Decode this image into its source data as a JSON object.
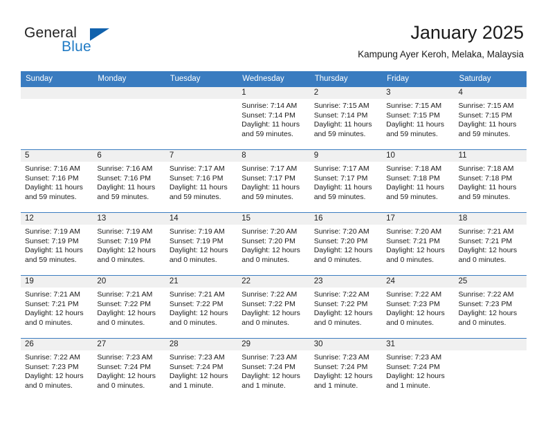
{
  "brand": {
    "word_general": "General",
    "word_blue": "Blue",
    "triangle_icon": "triangle-icon",
    "accent_color": "#1f7ac4",
    "triangle_color": "#1162ad"
  },
  "header": {
    "title": "January 2025",
    "subtitle": "Kampung Ayer Keroh, Melaka, Malaysia"
  },
  "calendar": {
    "header_bg": "#3a7cc0",
    "daynum_bg": "#f0f0f0",
    "weekday_headers": [
      "Sunday",
      "Monday",
      "Tuesday",
      "Wednesday",
      "Thursday",
      "Friday",
      "Saturday"
    ],
    "weeks": [
      [
        {
          "day": "",
          "empty": true,
          "sunrise": "",
          "sunset": "",
          "daylight_line1": "",
          "daylight_line2": ""
        },
        {
          "day": "",
          "empty": true,
          "sunrise": "",
          "sunset": "",
          "daylight_line1": "",
          "daylight_line2": ""
        },
        {
          "day": "",
          "empty": true,
          "sunrise": "",
          "sunset": "",
          "daylight_line1": "",
          "daylight_line2": ""
        },
        {
          "day": "1",
          "empty": false,
          "sunrise": "Sunrise: 7:14 AM",
          "sunset": "Sunset: 7:14 PM",
          "daylight_line1": "Daylight: 11 hours",
          "daylight_line2": "and 59 minutes."
        },
        {
          "day": "2",
          "empty": false,
          "sunrise": "Sunrise: 7:15 AM",
          "sunset": "Sunset: 7:14 PM",
          "daylight_line1": "Daylight: 11 hours",
          "daylight_line2": "and 59 minutes."
        },
        {
          "day": "3",
          "empty": false,
          "sunrise": "Sunrise: 7:15 AM",
          "sunset": "Sunset: 7:15 PM",
          "daylight_line1": "Daylight: 11 hours",
          "daylight_line2": "and 59 minutes."
        },
        {
          "day": "4",
          "empty": false,
          "sunrise": "Sunrise: 7:15 AM",
          "sunset": "Sunset: 7:15 PM",
          "daylight_line1": "Daylight: 11 hours",
          "daylight_line2": "and 59 minutes."
        }
      ],
      [
        {
          "day": "5",
          "empty": false,
          "sunrise": "Sunrise: 7:16 AM",
          "sunset": "Sunset: 7:16 PM",
          "daylight_line1": "Daylight: 11 hours",
          "daylight_line2": "and 59 minutes."
        },
        {
          "day": "6",
          "empty": false,
          "sunrise": "Sunrise: 7:16 AM",
          "sunset": "Sunset: 7:16 PM",
          "daylight_line1": "Daylight: 11 hours",
          "daylight_line2": "and 59 minutes."
        },
        {
          "day": "7",
          "empty": false,
          "sunrise": "Sunrise: 7:17 AM",
          "sunset": "Sunset: 7:16 PM",
          "daylight_line1": "Daylight: 11 hours",
          "daylight_line2": "and 59 minutes."
        },
        {
          "day": "8",
          "empty": false,
          "sunrise": "Sunrise: 7:17 AM",
          "sunset": "Sunset: 7:17 PM",
          "daylight_line1": "Daylight: 11 hours",
          "daylight_line2": "and 59 minutes."
        },
        {
          "day": "9",
          "empty": false,
          "sunrise": "Sunrise: 7:17 AM",
          "sunset": "Sunset: 7:17 PM",
          "daylight_line1": "Daylight: 11 hours",
          "daylight_line2": "and 59 minutes."
        },
        {
          "day": "10",
          "empty": false,
          "sunrise": "Sunrise: 7:18 AM",
          "sunset": "Sunset: 7:18 PM",
          "daylight_line1": "Daylight: 11 hours",
          "daylight_line2": "and 59 minutes."
        },
        {
          "day": "11",
          "empty": false,
          "sunrise": "Sunrise: 7:18 AM",
          "sunset": "Sunset: 7:18 PM",
          "daylight_line1": "Daylight: 11 hours",
          "daylight_line2": "and 59 minutes."
        }
      ],
      [
        {
          "day": "12",
          "empty": false,
          "sunrise": "Sunrise: 7:19 AM",
          "sunset": "Sunset: 7:19 PM",
          "daylight_line1": "Daylight: 11 hours",
          "daylight_line2": "and 59 minutes."
        },
        {
          "day": "13",
          "empty": false,
          "sunrise": "Sunrise: 7:19 AM",
          "sunset": "Sunset: 7:19 PM",
          "daylight_line1": "Daylight: 12 hours",
          "daylight_line2": "and 0 minutes."
        },
        {
          "day": "14",
          "empty": false,
          "sunrise": "Sunrise: 7:19 AM",
          "sunset": "Sunset: 7:19 PM",
          "daylight_line1": "Daylight: 12 hours",
          "daylight_line2": "and 0 minutes."
        },
        {
          "day": "15",
          "empty": false,
          "sunrise": "Sunrise: 7:20 AM",
          "sunset": "Sunset: 7:20 PM",
          "daylight_line1": "Daylight: 12 hours",
          "daylight_line2": "and 0 minutes."
        },
        {
          "day": "16",
          "empty": false,
          "sunrise": "Sunrise: 7:20 AM",
          "sunset": "Sunset: 7:20 PM",
          "daylight_line1": "Daylight: 12 hours",
          "daylight_line2": "and 0 minutes."
        },
        {
          "day": "17",
          "empty": false,
          "sunrise": "Sunrise: 7:20 AM",
          "sunset": "Sunset: 7:21 PM",
          "daylight_line1": "Daylight: 12 hours",
          "daylight_line2": "and 0 minutes."
        },
        {
          "day": "18",
          "empty": false,
          "sunrise": "Sunrise: 7:21 AM",
          "sunset": "Sunset: 7:21 PM",
          "daylight_line1": "Daylight: 12 hours",
          "daylight_line2": "and 0 minutes."
        }
      ],
      [
        {
          "day": "19",
          "empty": false,
          "sunrise": "Sunrise: 7:21 AM",
          "sunset": "Sunset: 7:21 PM",
          "daylight_line1": "Daylight: 12 hours",
          "daylight_line2": "and 0 minutes."
        },
        {
          "day": "20",
          "empty": false,
          "sunrise": "Sunrise: 7:21 AM",
          "sunset": "Sunset: 7:22 PM",
          "daylight_line1": "Daylight: 12 hours",
          "daylight_line2": "and 0 minutes."
        },
        {
          "day": "21",
          "empty": false,
          "sunrise": "Sunrise: 7:21 AM",
          "sunset": "Sunset: 7:22 PM",
          "daylight_line1": "Daylight: 12 hours",
          "daylight_line2": "and 0 minutes."
        },
        {
          "day": "22",
          "empty": false,
          "sunrise": "Sunrise: 7:22 AM",
          "sunset": "Sunset: 7:22 PM",
          "daylight_line1": "Daylight: 12 hours",
          "daylight_line2": "and 0 minutes."
        },
        {
          "day": "23",
          "empty": false,
          "sunrise": "Sunrise: 7:22 AM",
          "sunset": "Sunset: 7:22 PM",
          "daylight_line1": "Daylight: 12 hours",
          "daylight_line2": "and 0 minutes."
        },
        {
          "day": "24",
          "empty": false,
          "sunrise": "Sunrise: 7:22 AM",
          "sunset": "Sunset: 7:23 PM",
          "daylight_line1": "Daylight: 12 hours",
          "daylight_line2": "and 0 minutes."
        },
        {
          "day": "25",
          "empty": false,
          "sunrise": "Sunrise: 7:22 AM",
          "sunset": "Sunset: 7:23 PM",
          "daylight_line1": "Daylight: 12 hours",
          "daylight_line2": "and 0 minutes."
        }
      ],
      [
        {
          "day": "26",
          "empty": false,
          "sunrise": "Sunrise: 7:22 AM",
          "sunset": "Sunset: 7:23 PM",
          "daylight_line1": "Daylight: 12 hours",
          "daylight_line2": "and 0 minutes."
        },
        {
          "day": "27",
          "empty": false,
          "sunrise": "Sunrise: 7:23 AM",
          "sunset": "Sunset: 7:24 PM",
          "daylight_line1": "Daylight: 12 hours",
          "daylight_line2": "and 0 minutes."
        },
        {
          "day": "28",
          "empty": false,
          "sunrise": "Sunrise: 7:23 AM",
          "sunset": "Sunset: 7:24 PM",
          "daylight_line1": "Daylight: 12 hours",
          "daylight_line2": "and 1 minute."
        },
        {
          "day": "29",
          "empty": false,
          "sunrise": "Sunrise: 7:23 AM",
          "sunset": "Sunset: 7:24 PM",
          "daylight_line1": "Daylight: 12 hours",
          "daylight_line2": "and 1 minute."
        },
        {
          "day": "30",
          "empty": false,
          "sunrise": "Sunrise: 7:23 AM",
          "sunset": "Sunset: 7:24 PM",
          "daylight_line1": "Daylight: 12 hours",
          "daylight_line2": "and 1 minute."
        },
        {
          "day": "31",
          "empty": false,
          "sunrise": "Sunrise: 7:23 AM",
          "sunset": "Sunset: 7:24 PM",
          "daylight_line1": "Daylight: 12 hours",
          "daylight_line2": "and 1 minute."
        },
        {
          "day": "",
          "empty": true,
          "sunrise": "",
          "sunset": "",
          "daylight_line1": "",
          "daylight_line2": ""
        }
      ]
    ]
  }
}
